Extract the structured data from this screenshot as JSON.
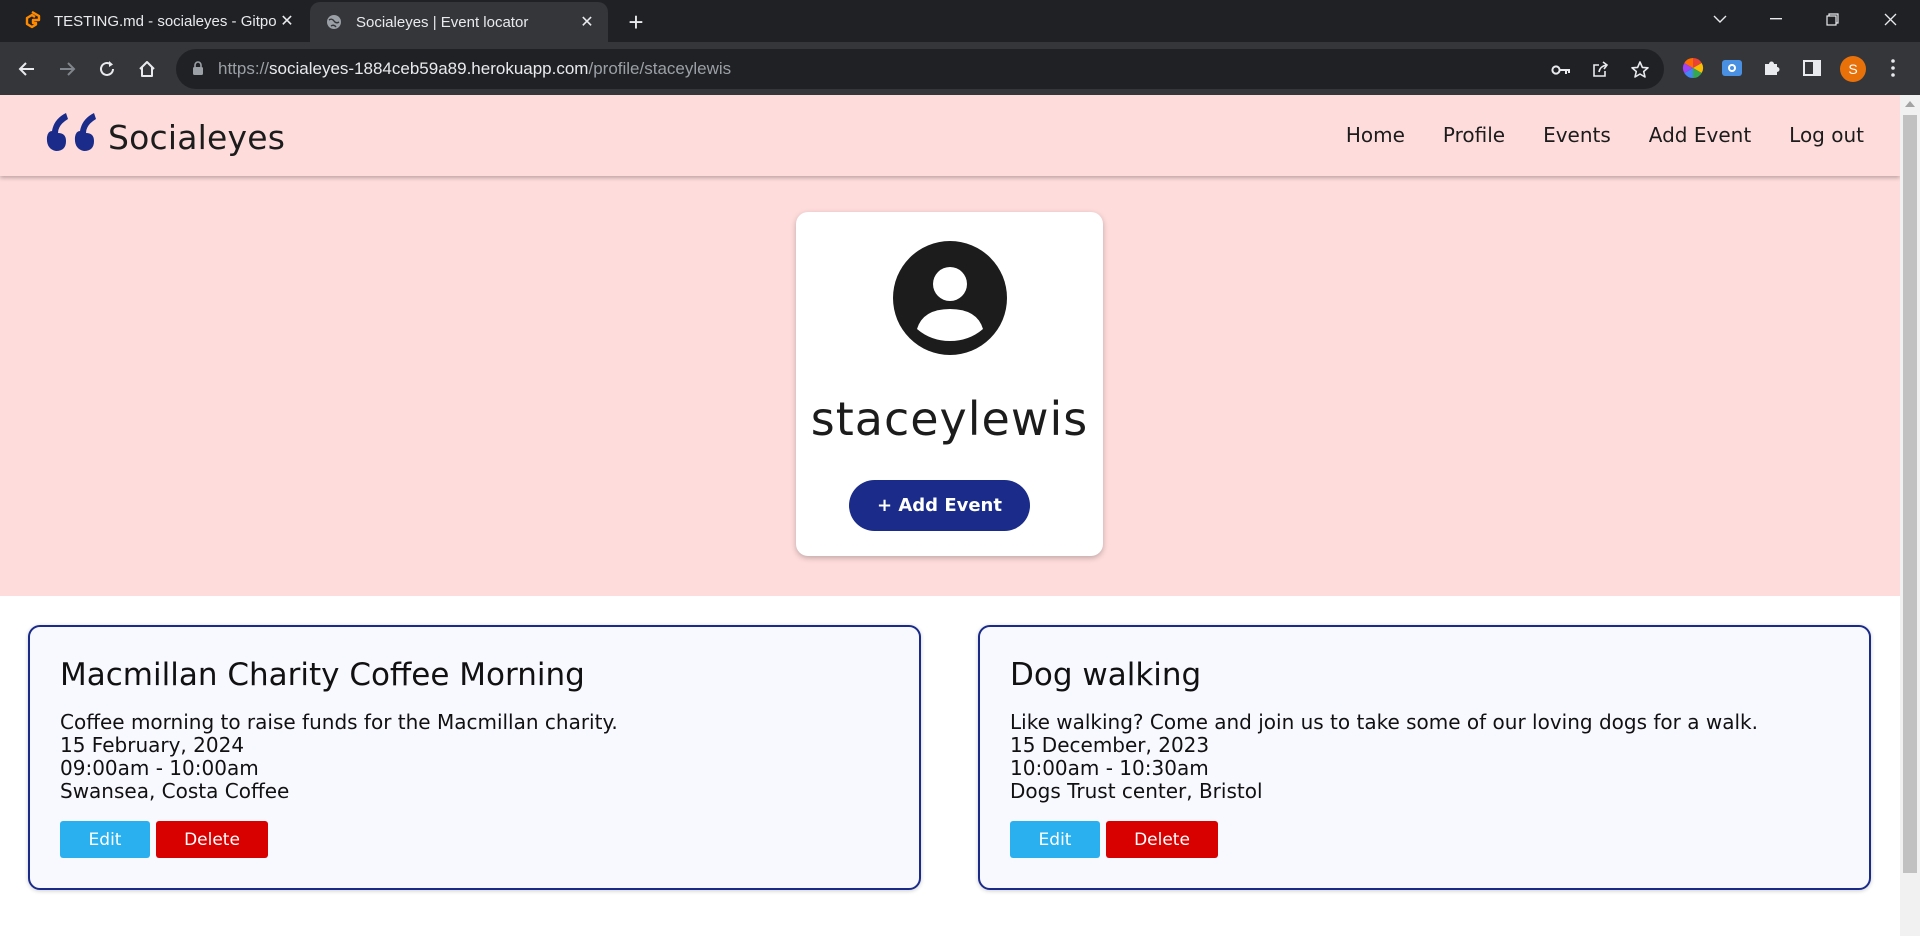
{
  "browser": {
    "tabs": [
      {
        "title": "TESTING.md - socialeyes - Gitpo",
        "icon": "gitpod-icon",
        "active": false
      },
      {
        "title": "Socialeyes | Event locator",
        "icon": "globe-icon",
        "active": true
      }
    ],
    "url": {
      "scheme": "https://",
      "host": "socialeyes-1884ceb59a89.herokuapp.com",
      "path": "/profile/staceylewis"
    },
    "profile_initial": "S",
    "colors": {
      "frame": "#202124",
      "toolbar": "#35363a",
      "avatar": "#e8710a"
    }
  },
  "site": {
    "brand": "Socialeyes",
    "nav": [
      "Home",
      "Profile",
      "Events",
      "Add Event",
      "Log out"
    ],
    "colors": {
      "hero": "#ffdcdc",
      "primary": "#1a2b8a",
      "edit": "#2ab0ef",
      "delete": "#d90000"
    }
  },
  "profile": {
    "username": "staceylewis",
    "add_event_label": "+ Add Event"
  },
  "events": [
    {
      "title": "Macmillan Charity Coffee Morning",
      "description": "Coffee morning to raise funds for the Macmillan charity.",
      "date": "15 February, 2024",
      "time": "09:00am - 10:00am",
      "location": "Swansea, Costa Coffee",
      "edit_label": "Edit",
      "delete_label": "Delete"
    },
    {
      "title": "Dog walking",
      "description": "Like walking? Come and join us to take some of our loving dogs for a walk.",
      "date": "15 December, 2023",
      "time": "10:00am - 10:30am",
      "location": "Dogs Trust center, Bristol",
      "edit_label": "Edit",
      "delete_label": "Delete"
    }
  ]
}
